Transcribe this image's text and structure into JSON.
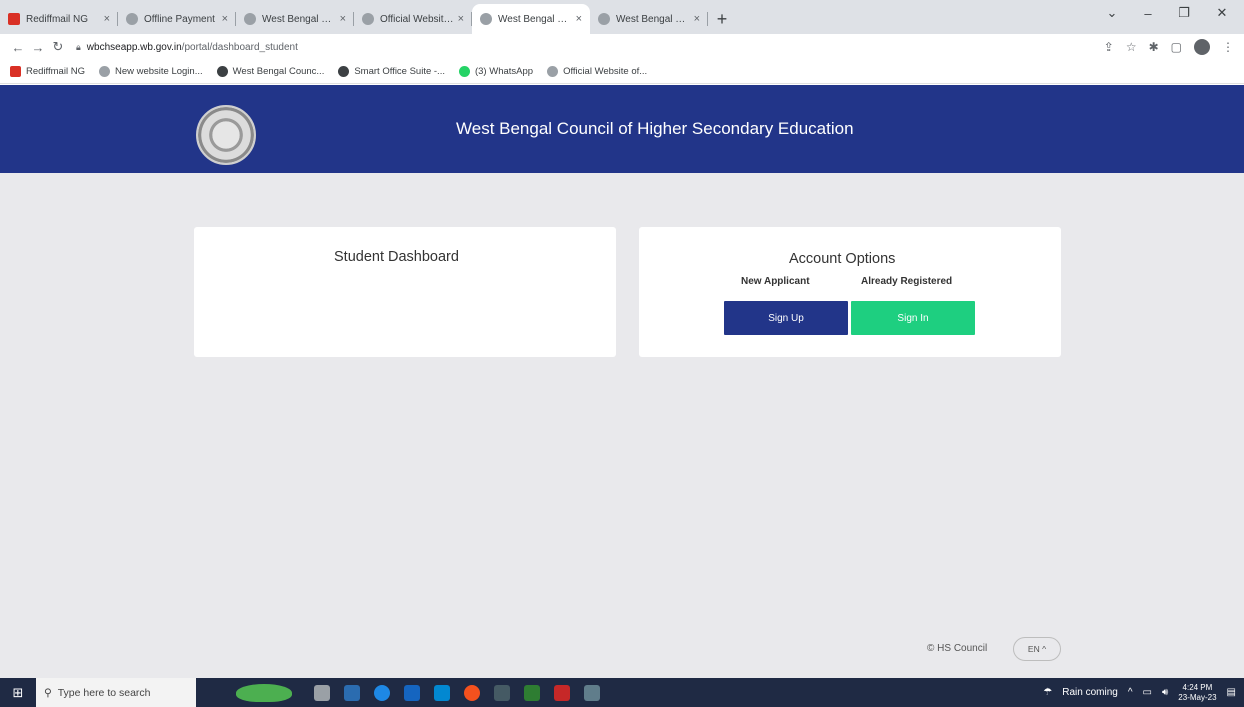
{
  "browser": {
    "tabs": [
      {
        "title": "Rediffmail NG",
        "icon": "rediffmail-icon",
        "active": false
      },
      {
        "title": "Offline Payment",
        "icon": "globe-icon",
        "active": false
      },
      {
        "title": "West Bengal Council of High",
        "icon": "globe-icon",
        "active": false
      },
      {
        "title": "Official Website of West Beng",
        "icon": "globe-icon",
        "active": false
      },
      {
        "title": "West Bengal Council of High",
        "icon": "globe-icon",
        "active": true
      },
      {
        "title": "West Bengal Council of High",
        "icon": "globe-icon",
        "active": false
      }
    ],
    "close_glyph": "×",
    "new_tab_glyph": "+",
    "url_host": "wbchseapp.wb.gov.in",
    "url_path": "/portal/dashboard_student",
    "bookmarks": [
      {
        "label": "Rediffmail NG",
        "icon": "rediffmail-icon"
      },
      {
        "label": "New website Login...",
        "icon": "globe-icon"
      },
      {
        "label": "West Bengal Counc...",
        "icon": "web-icon"
      },
      {
        "label": "Smart Office Suite -...",
        "icon": "web-icon"
      },
      {
        "label": "(3) WhatsApp",
        "icon": "whatsapp-icon"
      },
      {
        "label": "Official Website of...",
        "icon": "globe-icon"
      }
    ]
  },
  "page": {
    "banner_title": "West Bengal Council of Higher Secondary Education",
    "student_card_title": "Student Dashboard",
    "account_card_title": "Account Options",
    "new_applicant_label": "New Applicant",
    "already_registered_label": "Already Registered",
    "sign_up_label": "Sign Up",
    "sign_in_label": "Sign In",
    "footer_text": "© HS Council",
    "language_label": "EN ^",
    "colors": {
      "banner": "#223589",
      "sign_up": "#223589",
      "sign_in": "#1ecf80",
      "background": "#e9e9ec"
    }
  },
  "taskbar": {
    "search_placeholder": "Type here to search",
    "weather": "Rain coming",
    "time": "4:24 PM",
    "date": "23-May-23"
  }
}
